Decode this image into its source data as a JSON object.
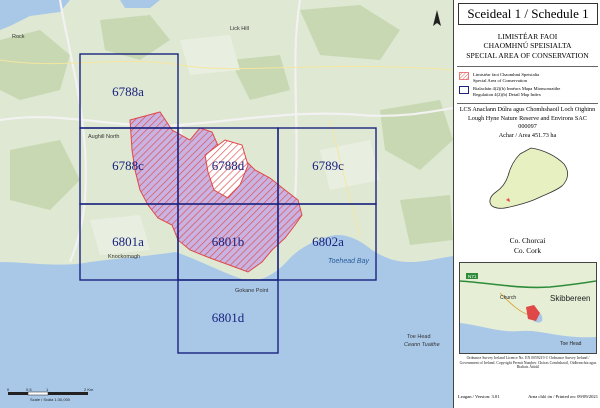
{
  "map": {
    "grid_labels": [
      "6788a",
      "6788c",
      "6788d",
      "6789c",
      "6801a",
      "6801b",
      "6802a",
      "6801d"
    ],
    "place_labels": {
      "lick_hill": "Lick Hill",
      "toehead_bay": "Toehead Bay",
      "gokane_point": "Gokane Point",
      "toe_head": "Toe Head",
      "ceann_tuaithe": "Ceann Tuaithe",
      "rock": "Rock",
      "knockomagh": "Knockomagh",
      "aughill_north": "Aughill North"
    },
    "scale_ticks": [
      "0",
      "0.5",
      "1",
      "2 Km"
    ],
    "scale_text": "Scale / Scála 1:30,000"
  },
  "panel": {
    "title": "Sceideal 1 / Schedule 1",
    "limit_lines": [
      "LIMISTÉAR FAOI",
      "CHAOMHNÚ SPEISIALTA",
      "SPECIAL AREA OF CONSERVATION"
    ],
    "legend": [
      {
        "text_ga": "Limistéar faoi Chaomhnú Speisialta",
        "text_en": "Special Area of Conservation"
      },
      {
        "text_ga": "Rialachán 4(2)(b) Innéacs Mapa Mionsonraithe",
        "text_en": "Regulation 4(2)(b) Detail Map Index"
      }
    ],
    "site_name_ga": "LCS Anaclann Dúlra agus Chomhshaoil Loch Oighinn",
    "site_name_en": "Lough Hyne Nature Reserve and Environs SAC",
    "site_code": "000097",
    "area": "Achar / Area 451.73 ha",
    "county_ga": "Co. Chorcaí",
    "county_en": "Co. Cork",
    "inset_labels": {
      "skibbereen": "Skibbereen",
      "church": "Church",
      "toe_head": "Toe Head",
      "road": "N71"
    },
    "footer_note": "Ordnance Survey Ireland Licence No. EN 0059219 © Ordnance Survey Ireland / Government of Ireland. Copyright Permit Number. Chóras Comhshaoil, Oidhreachta agus Rialtais Áitiúil",
    "version": "Leagan / Version: 3.01",
    "printed": "Arna chló ón / Printed on: 09/09/2021"
  },
  "colors": {
    "sea": "#a9c8e8",
    "land": "#dfe8d2",
    "woodland": "#c5d6b0",
    "sac_fill": "#c8aee0",
    "sac_hatch": "#e0484a",
    "grid_line": "#1a237e"
  }
}
